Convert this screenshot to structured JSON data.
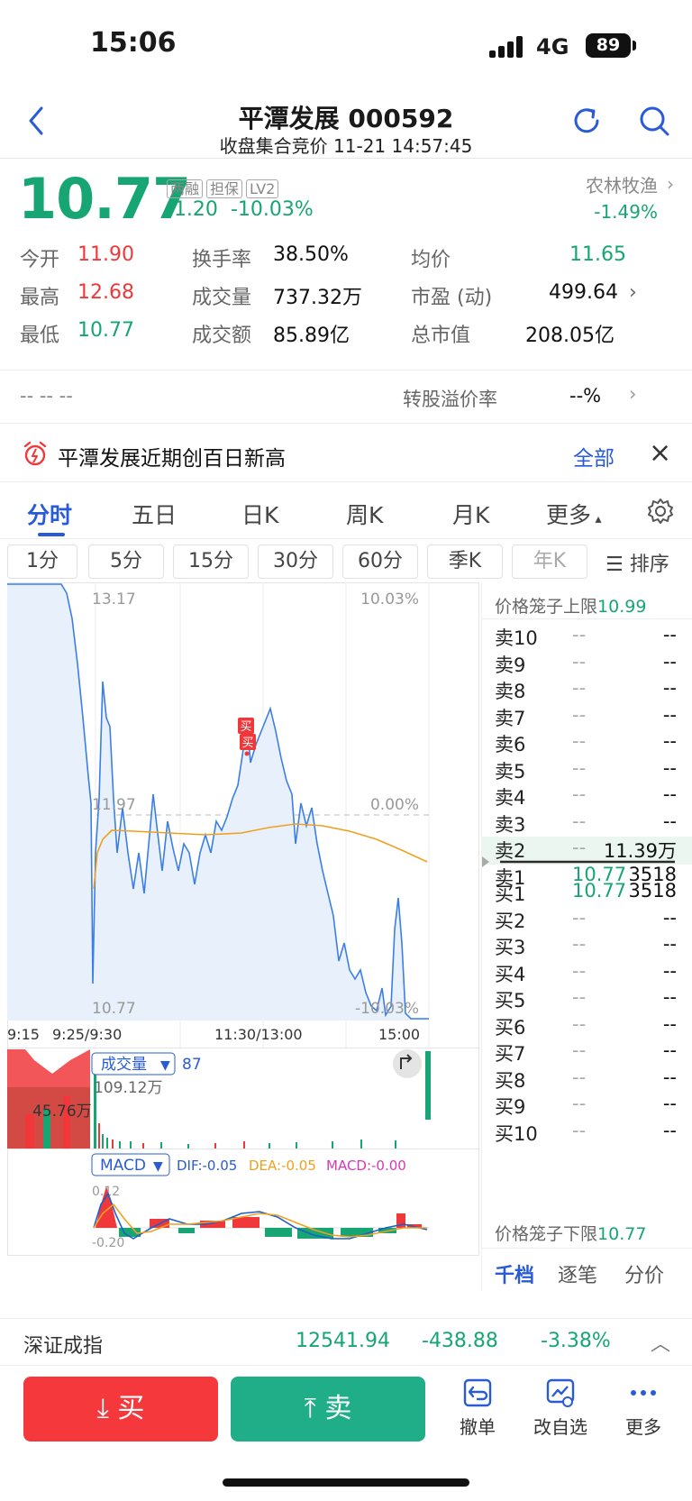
{
  "status": {
    "time": "15:06",
    "network": "4G",
    "battery": "89"
  },
  "nav": {
    "title": "平潭发展 000592",
    "subtitle": "收盘集合竞价 11-21 14:57:45"
  },
  "quote": {
    "price": "10.77",
    "tags": [
      "两融",
      "担保",
      "LV2"
    ],
    "change": "-1.20",
    "change_pct": "-10.03%",
    "sector_name": "农林牧渔",
    "sector_pct": "-1.49%"
  },
  "stats": {
    "open_label": "今开",
    "open": "11.90",
    "high_label": "最高",
    "high": "12.68",
    "low_label": "最低",
    "low": "10.77",
    "turnover_label": "换手率",
    "turnover": "38.50%",
    "volume_label": "成交量",
    "volume": "737.32万",
    "amount_label": "成交额",
    "amount": "85.89亿",
    "avg_label": "均价",
    "avg": "11.65",
    "pe_label": "市盈 (动)",
    "pe": "499.64",
    "mcap_label": "总市值",
    "mcap": "208.05亿"
  },
  "conv": {
    "left": "-- -- --",
    "label": "转股溢价率",
    "value": "--%"
  },
  "notice": {
    "text": "平潭发展近期创百日新高",
    "all": "全部"
  },
  "tabs": [
    "分时",
    "五日",
    "日K",
    "周K",
    "月K",
    "更多"
  ],
  "subtabs": [
    "1分",
    "5分",
    "15分",
    "30分",
    "60分",
    "季K",
    "年K"
  ],
  "sort_label": "排序",
  "chart": {
    "price_top": "13.17",
    "price_mid": "11.97",
    "price_bot": "10.77",
    "pct_top": "10.03%",
    "pct_mid": "0.00%",
    "pct_bot": "-10.03%",
    "times": [
      "9:15",
      "9:25/9:30",
      "11:30/13:00",
      "15:00"
    ],
    "buy_marks": [
      "买",
      "买"
    ],
    "vol_label": "成交量",
    "vol_num": "87",
    "vol_max": "109.12万",
    "vol_left": "45.76万",
    "macd_label": "MACD",
    "dif": "DIF:-0.05",
    "dea": "DEA:-0.05",
    "macd": "MACD:-0.00",
    "macd_top": "0.12",
    "macd_bot": "-0.20"
  },
  "book": {
    "upper_limit_label": "价格笼子上限",
    "upper_limit": "10.99",
    "lower_limit_label": "价格笼子下限",
    "lower_limit": "10.77",
    "asks": [
      {
        "label": "卖10",
        "price": "--",
        "vol": "--"
      },
      {
        "label": "卖9",
        "price": "--",
        "vol": "--"
      },
      {
        "label": "卖8",
        "price": "--",
        "vol": "--"
      },
      {
        "label": "卖7",
        "price": "--",
        "vol": "--"
      },
      {
        "label": "卖6",
        "price": "--",
        "vol": "--"
      },
      {
        "label": "卖5",
        "price": "--",
        "vol": "--"
      },
      {
        "label": "卖4",
        "price": "--",
        "vol": "--"
      },
      {
        "label": "卖3",
        "price": "--",
        "vol": "--"
      },
      {
        "label": "卖2",
        "price": "--",
        "vol": "11.39万"
      },
      {
        "label": "卖1",
        "price": "10.77",
        "vol": "3518"
      }
    ],
    "bids": [
      {
        "label": "买1",
        "price": "10.77",
        "vol": "3518"
      },
      {
        "label": "买2",
        "price": "--",
        "vol": "--"
      },
      {
        "label": "买3",
        "price": "--",
        "vol": "--"
      },
      {
        "label": "买4",
        "price": "--",
        "vol": "--"
      },
      {
        "label": "买5",
        "price": "--",
        "vol": "--"
      },
      {
        "label": "买6",
        "price": "--",
        "vol": "--"
      },
      {
        "label": "买7",
        "price": "--",
        "vol": "--"
      },
      {
        "label": "买8",
        "price": "--",
        "vol": "--"
      },
      {
        "label": "买9",
        "price": "--",
        "vol": "--"
      },
      {
        "label": "买10",
        "price": "--",
        "vol": "--"
      }
    ],
    "tabs": [
      "千档",
      "逐笔",
      "分价"
    ]
  },
  "index": {
    "name": "深证成指",
    "value": "12541.94",
    "change": "-438.88",
    "pct": "-3.38%"
  },
  "actions": {
    "buy": "买",
    "sell": "卖",
    "cancel": "撤单",
    "watch": "改自选",
    "more": "更多"
  },
  "colors": {
    "up": "#f0383b",
    "down": "#17a673",
    "accent": "#2a5bd7",
    "avg_line": "#f0a020",
    "price_line": "#3b7ee8"
  }
}
